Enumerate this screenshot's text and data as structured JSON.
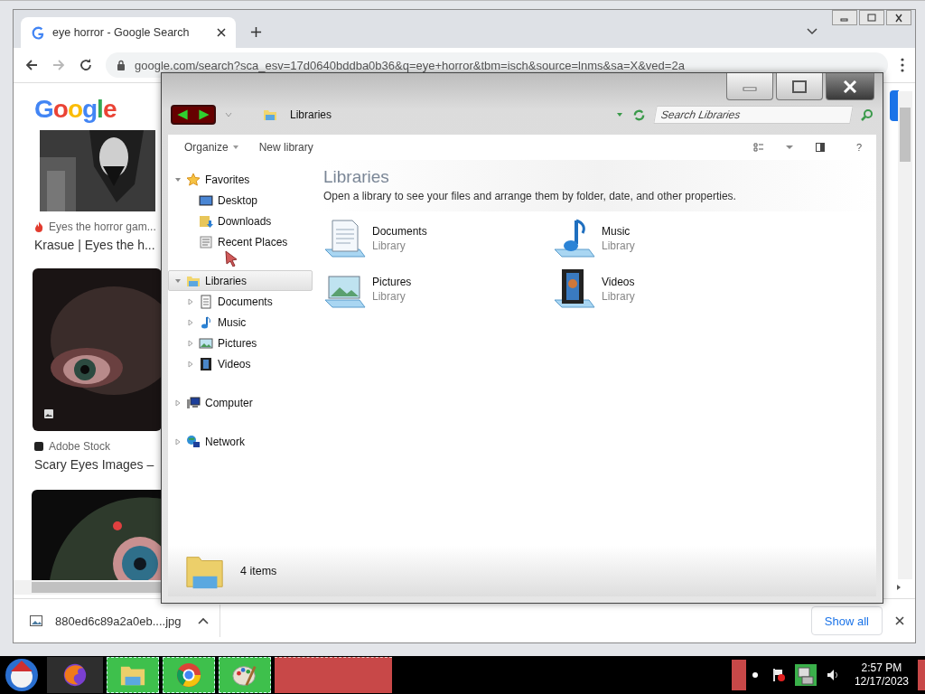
{
  "browser": {
    "tab": {
      "title": "eye horror - Google Search"
    },
    "toolbar": {
      "forward_disabled": true,
      "address": "google.com/search?sca_esv=17d0640bddba0b36&q=eye+horror&tbm=isch&source=lnms&sa=X&ved=2a"
    },
    "logo": "Google",
    "results": [
      {
        "source": "Eyes the horror gam...",
        "title": "Krasue | Eyes the h..."
      },
      {
        "source": "Adobe Stock",
        "title": "Scary Eyes Images –"
      }
    ],
    "download": {
      "file": "880ed6c89a2a0eb....jpg",
      "show_all": "Show all"
    }
  },
  "explorer": {
    "breadcrumb": "Libraries",
    "search": {
      "placeholder": "Search Libraries"
    },
    "toolbar": [
      "Organize",
      "New library"
    ],
    "help": "?",
    "nav": [
      {
        "label": "Favorites",
        "kind": "star",
        "expanded": true,
        "selected": false,
        "children": [
          {
            "label": "Desktop",
            "kind": "desktop",
            "selected": false
          },
          {
            "label": "Downloads",
            "kind": "downloads",
            "selected": false
          },
          {
            "label": "Recent Places",
            "kind": "recent",
            "selected": false
          }
        ]
      },
      {
        "label": "Libraries",
        "kind": "library",
        "expanded": true,
        "selected": true,
        "children": [
          {
            "label": "Documents",
            "kind": "documents",
            "expanded": false,
            "selected": false
          },
          {
            "label": "Music",
            "kind": "music",
            "expanded": false,
            "selected": false
          },
          {
            "label": "Pictures",
            "kind": "pictures",
            "expanded": false,
            "selected": false
          },
          {
            "label": "Videos",
            "kind": "videos",
            "expanded": false,
            "selected": false
          }
        ]
      },
      {
        "label": "Computer",
        "kind": "computer",
        "expanded": false,
        "selected": false
      },
      {
        "label": "Network",
        "kind": "network",
        "expanded": false,
        "selected": false
      }
    ],
    "heading": "Libraries",
    "description": "Open a library to see your files and arrange them by folder, date, and other properties.",
    "items": [
      {
        "name": "Documents",
        "type": "Library",
        "kind": "documents"
      },
      {
        "name": "Music",
        "type": "Library",
        "kind": "music"
      },
      {
        "name": "Pictures",
        "type": "Library",
        "kind": "pictures"
      },
      {
        "name": "Videos",
        "type": "Library",
        "kind": "videos"
      }
    ],
    "status": "4 items"
  },
  "taskbar": {
    "time": "2:57 PM",
    "date": "12/17/2023"
  }
}
